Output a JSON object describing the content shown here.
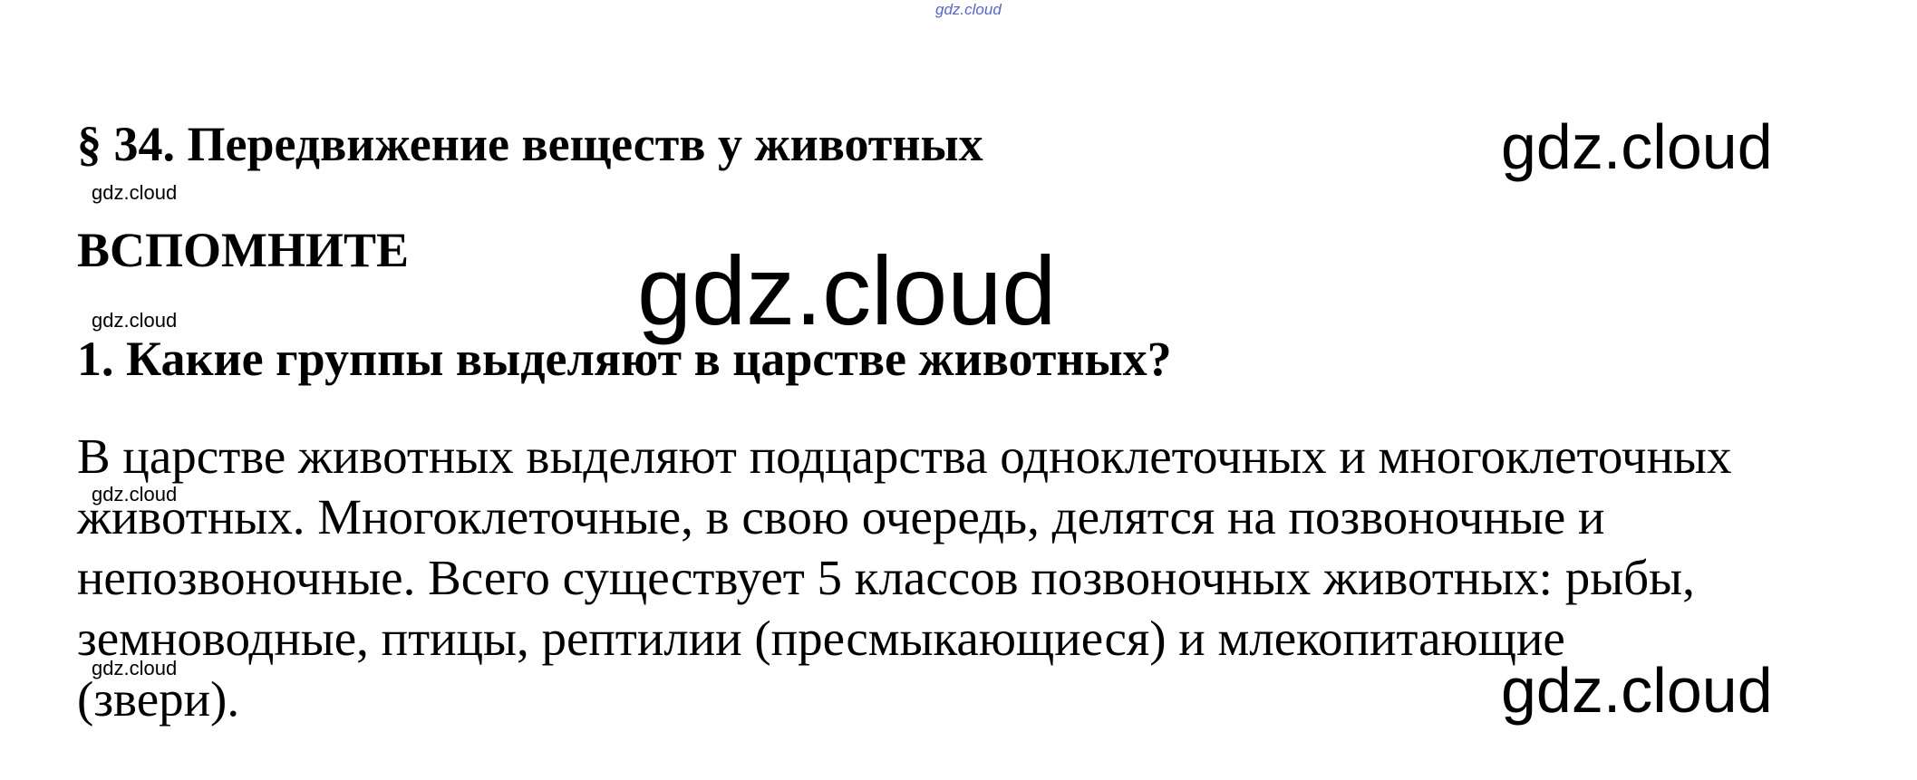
{
  "watermark": {
    "top": "gdz.cloud",
    "label": "gdz.cloud"
  },
  "section": {
    "title": "§  34. Передвижение веществ у животных"
  },
  "remember": {
    "heading": "ВСПОМНИТЕ"
  },
  "question": {
    "text": "1.  Какие группы выделяют в царстве животных?"
  },
  "answer": {
    "lines": [
      "В царстве животных выделяют подцарства одноклеточных и многоклеточных",
      "животных. Многоклеточные, в свою очередь, делятся  на позвоночные и",
      "непозвоночные. Всего существует 5 классов позвоночных животных: рыбы,",
      "земноводные, птицы, рептилии (пресмыкающиеся) и млекопитающие",
      "(звери)."
    ]
  }
}
